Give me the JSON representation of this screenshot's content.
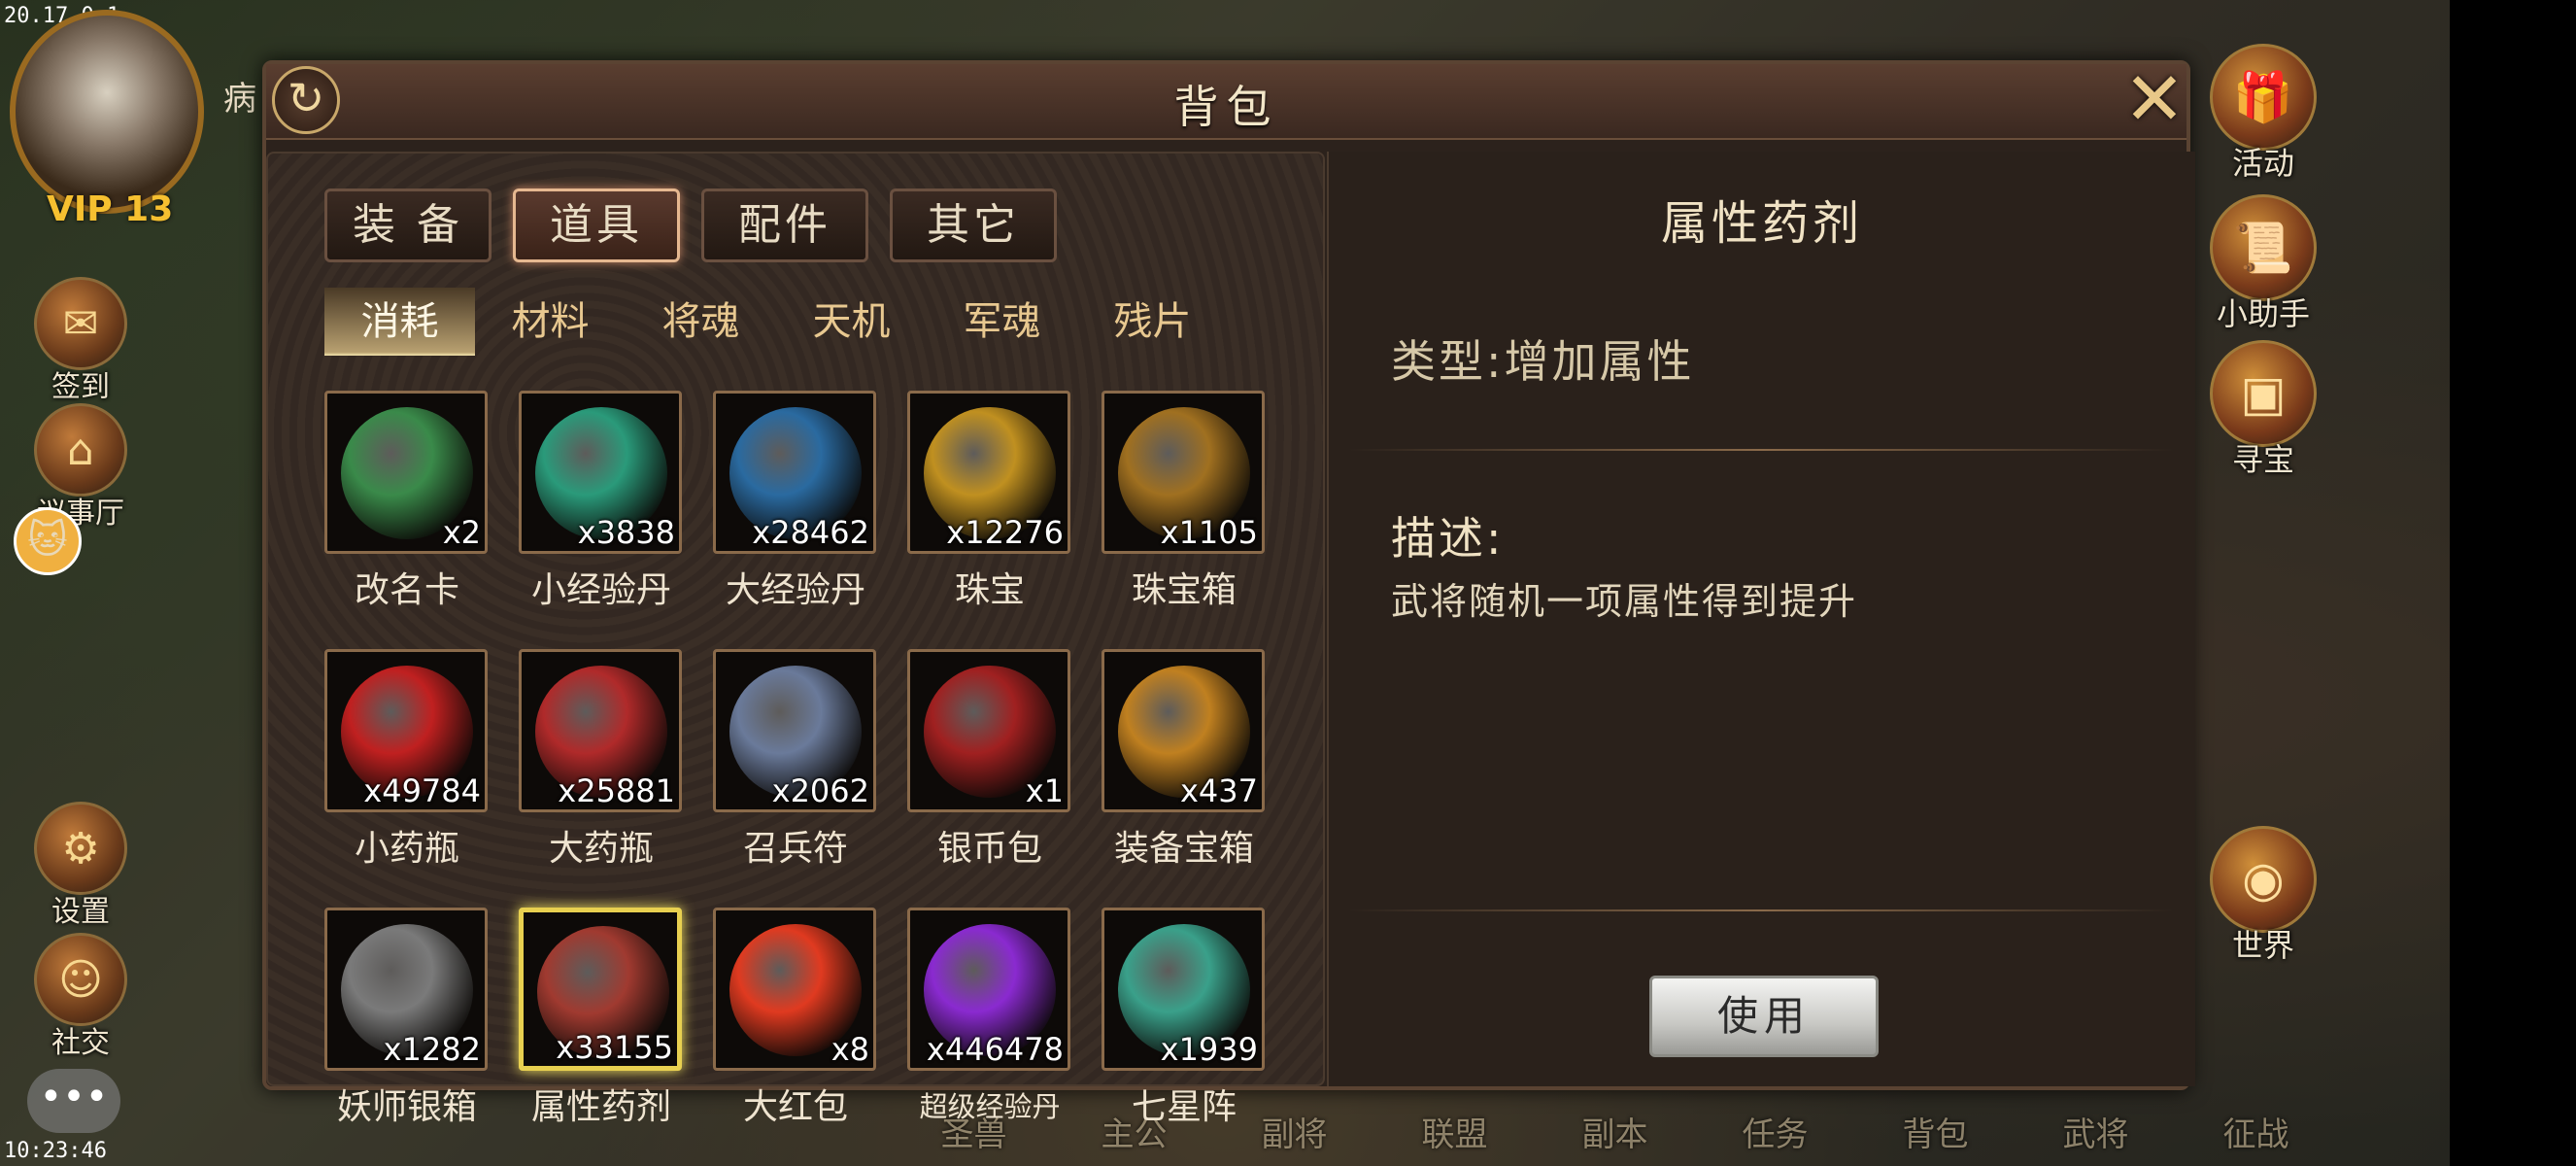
{
  "status_bar": {
    "ip": "20.17.0.1",
    "time": "10:23:46"
  },
  "player": {
    "vip": "VIP 13",
    "name_fragment": "病"
  },
  "left_menu": [
    {
      "label": "签到",
      "icon": "checkin-icon"
    },
    {
      "label": "议事厅",
      "icon": "council-hall-icon"
    },
    {
      "label": "设置",
      "icon": "settings-gear-icon"
    },
    {
      "label": "社交",
      "icon": "social-icon"
    }
  ],
  "right_menu": [
    {
      "label": "活动",
      "icon": "gift-box-icon"
    },
    {
      "label": "小助手",
      "icon": "scroll-icon"
    },
    {
      "label": "寻宝",
      "icon": "treasure-chest-icon"
    },
    {
      "label": "世界",
      "icon": "world-icon"
    }
  ],
  "bottom_nav": [
    "圣兽",
    "主公",
    "副将",
    "联盟",
    "副本",
    "任务",
    "背包",
    "武将",
    "征战"
  ],
  "dialog": {
    "title": "背包",
    "tabs": [
      {
        "label": "装 备",
        "active": false
      },
      {
        "label": "道具",
        "active": true
      },
      {
        "label": "配件",
        "active": false
      },
      {
        "label": "其它",
        "active": false
      }
    ],
    "subtabs": [
      {
        "label": "消耗",
        "active": true
      },
      {
        "label": "材料",
        "active": false
      },
      {
        "label": "将魂",
        "active": false
      },
      {
        "label": "天机",
        "active": false
      },
      {
        "label": "军魂",
        "active": false
      },
      {
        "label": "残片",
        "active": false
      }
    ],
    "items": [
      {
        "name": "改名卡",
        "qty": "x2",
        "icon": "rename-card-icon",
        "color": "#3a8a4a"
      },
      {
        "name": "小经验丹",
        "qty": "x3838",
        "icon": "small-exp-orb-icon",
        "color": "#2a9a7a"
      },
      {
        "name": "大经验丹",
        "qty": "x28462",
        "icon": "large-exp-orb-icon",
        "color": "#2a6aa0"
      },
      {
        "name": "珠宝",
        "qty": "x12276",
        "icon": "jewelry-necklace-icon",
        "color": "#c09020"
      },
      {
        "name": "珠宝箱",
        "qty": "x1105",
        "icon": "jewelry-chest-icon",
        "color": "#a07020"
      },
      {
        "name": "小药瓶",
        "qty": "x49784",
        "icon": "small-potion-icon",
        "color": "#c02020"
      },
      {
        "name": "大药瓶",
        "qty": "x25881",
        "icon": "large-potion-icon",
        "color": "#b02a2a"
      },
      {
        "name": "召兵符",
        "qty": "x2062",
        "icon": "summon-talisman-icon",
        "color": "#6a7a9a"
      },
      {
        "name": "银币包",
        "qty": "x1",
        "icon": "silver-coin-bag-icon",
        "color": "#a02020"
      },
      {
        "name": "装备宝箱",
        "qty": "x437",
        "icon": "equipment-chest-icon",
        "color": "#c08020"
      },
      {
        "name": "妖师银箱",
        "qty": "x1282",
        "icon": "silver-chest-icon",
        "color": "#7a7a7a"
      },
      {
        "name": "属性药剂",
        "qty": "x33155",
        "icon": "attribute-potion-icon",
        "color": "#a03a30",
        "selected": true
      },
      {
        "name": "大红包",
        "qty": "x8",
        "icon": "red-envelope-icon",
        "color": "#e03a20"
      },
      {
        "name": "超级经验丹",
        "qty": "x446478",
        "icon": "super-exp-orb-icon",
        "color": "#8a2ad0",
        "small": true
      },
      {
        "name": "七星阵",
        "qty": "x1939",
        "icon": "seven-star-array-icon",
        "color": "#3aa08a"
      }
    ],
    "detail": {
      "title": "属性药剂",
      "type": "类型:增加属性",
      "desc_label": "描述:",
      "desc_text": "武将随机一项属性得到提升",
      "use_button": "使用"
    }
  }
}
